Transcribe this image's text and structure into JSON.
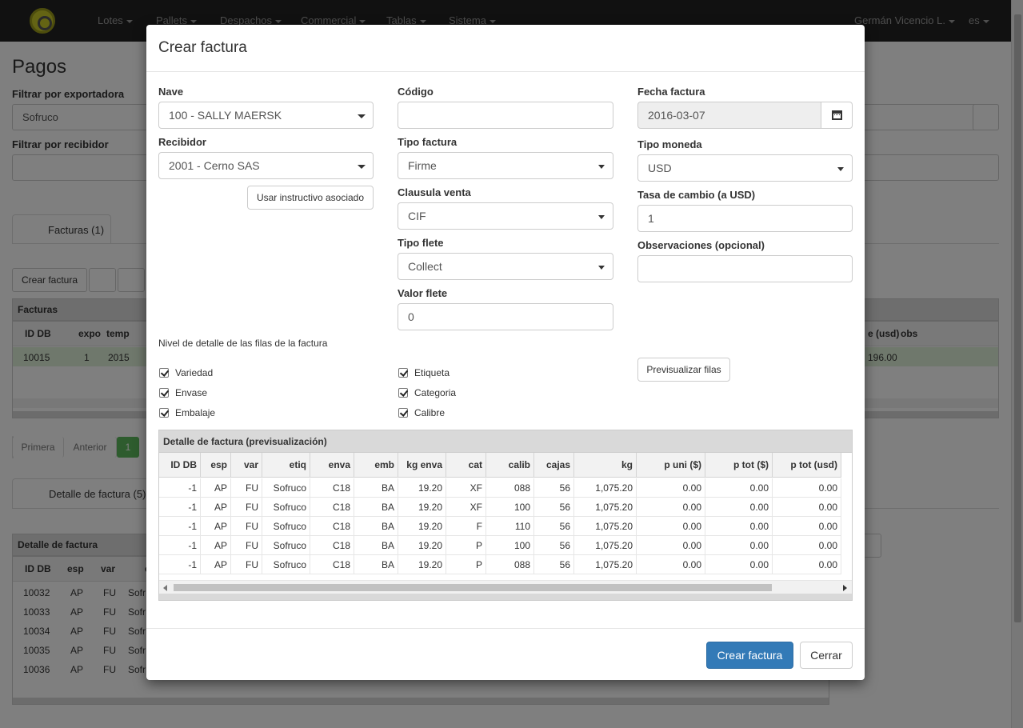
{
  "navbar": {
    "items": [
      "Lotes",
      "Pallets",
      "Despachos",
      "Commercial",
      "Tablas",
      "Sistema"
    ],
    "user": "Germán Vicencio L.",
    "lang": "es"
  },
  "background": {
    "title": "Pagos",
    "filter_exporter_label": "Filtrar por exportadora",
    "filter_exporter_value": "Sofruco",
    "filter_receiver_label": "Filtrar por recibidor",
    "tab_facturas": "Facturas (1)",
    "btn_crear_factura": "Crear factura",
    "panel_facturas": "Facturas",
    "facturas_cols": [
      "ID DB",
      "expo",
      "temp"
    ],
    "facturas_right_cols": [
      "e (usd)",
      "obs"
    ],
    "facturas_row": [
      "10015",
      "1",
      "2015"
    ],
    "facturas_row_right": "196.00",
    "pager": [
      "Primera",
      "Anterior",
      "1"
    ],
    "tab_detalle": "Detalle de factura (5)",
    "panel_detalle": "Detalle de factura",
    "detalle_cols": [
      "ID DB",
      "esp",
      "var",
      "e"
    ],
    "detalle_rows": [
      [
        "10032",
        "AP",
        "FU",
        "Sofr"
      ],
      [
        "10033",
        "AP",
        "FU",
        "Sofr"
      ],
      [
        "10034",
        "AP",
        "FU",
        "Sofr"
      ],
      [
        "10035",
        "AP",
        "FU",
        "Sofr"
      ],
      [
        "10036",
        "AP",
        "FU",
        "Sofr"
      ]
    ]
  },
  "modal": {
    "title": "Crear factura",
    "nave_label": "Nave",
    "nave_value": "100 - SALLY MAERSK",
    "recibidor_label": "Recibidor",
    "recibidor_value": "2001 - Cerno SAS",
    "usar_instructivo": "Usar instructivo asociado",
    "codigo_label": "Código",
    "codigo_value": "",
    "tipo_factura_label": "Tipo factura",
    "tipo_factura_value": "Firme",
    "clausula_label": "Clausula venta",
    "clausula_value": "CIF",
    "tipo_flete_label": "Tipo flete",
    "tipo_flete_value": "Collect",
    "valor_flete_label": "Valor flete",
    "valor_flete_value": "0",
    "fecha_label": "Fecha factura",
    "fecha_value": "2016-03-07",
    "moneda_label": "Tipo moneda",
    "moneda_value": "USD",
    "tasa_label": "Tasa de cambio (a USD)",
    "tasa_value": "1",
    "obs_label": "Observaciones (opcional)",
    "obs_value": "",
    "nivel_detalle": "Nivel de detalle de las filas de la factura",
    "checks_left": [
      "Variedad",
      "Envase",
      "Embalaje"
    ],
    "checks_right": [
      "Etiqueta",
      "Categoria",
      "Calibre"
    ],
    "previsualizar": "Previsualizar filas",
    "grid_caption": "Detalle de factura (previsualización)",
    "grid_cols": [
      "ID DB",
      "esp",
      "var",
      "etiq",
      "enva",
      "emb",
      "kg enva",
      "cat",
      "calib",
      "cajas",
      "kg",
      "p uni ($)",
      "p tot ($)",
      "p tot (usd)"
    ],
    "grid_rows": [
      [
        "-1",
        "AP",
        "FU",
        "Sofruco",
        "C18",
        "BA",
        "19.20",
        "XF",
        "088",
        "56",
        "1,075.20",
        "0.00",
        "0.00",
        "0.00"
      ],
      [
        "-1",
        "AP",
        "FU",
        "Sofruco",
        "C18",
        "BA",
        "19.20",
        "XF",
        "100",
        "56",
        "1,075.20",
        "0.00",
        "0.00",
        "0.00"
      ],
      [
        "-1",
        "AP",
        "FU",
        "Sofruco",
        "C18",
        "BA",
        "19.20",
        "F",
        "110",
        "56",
        "1,075.20",
        "0.00",
        "0.00",
        "0.00"
      ],
      [
        "-1",
        "AP",
        "FU",
        "Sofruco",
        "C18",
        "BA",
        "19.20",
        "P",
        "100",
        "56",
        "1,075.20",
        "0.00",
        "0.00",
        "0.00"
      ],
      [
        "-1",
        "AP",
        "FU",
        "Sofruco",
        "C18",
        "BA",
        "19.20",
        "P",
        "088",
        "56",
        "1,075.20",
        "0.00",
        "0.00",
        "0.00"
      ]
    ],
    "btn_crear": "Crear factura",
    "btn_cerrar": "Cerrar"
  },
  "colors": {
    "navbar": "#222222",
    "primary": "#337ab7",
    "selected_row": "#dff0d8",
    "pager_active": "#5cb85c"
  }
}
